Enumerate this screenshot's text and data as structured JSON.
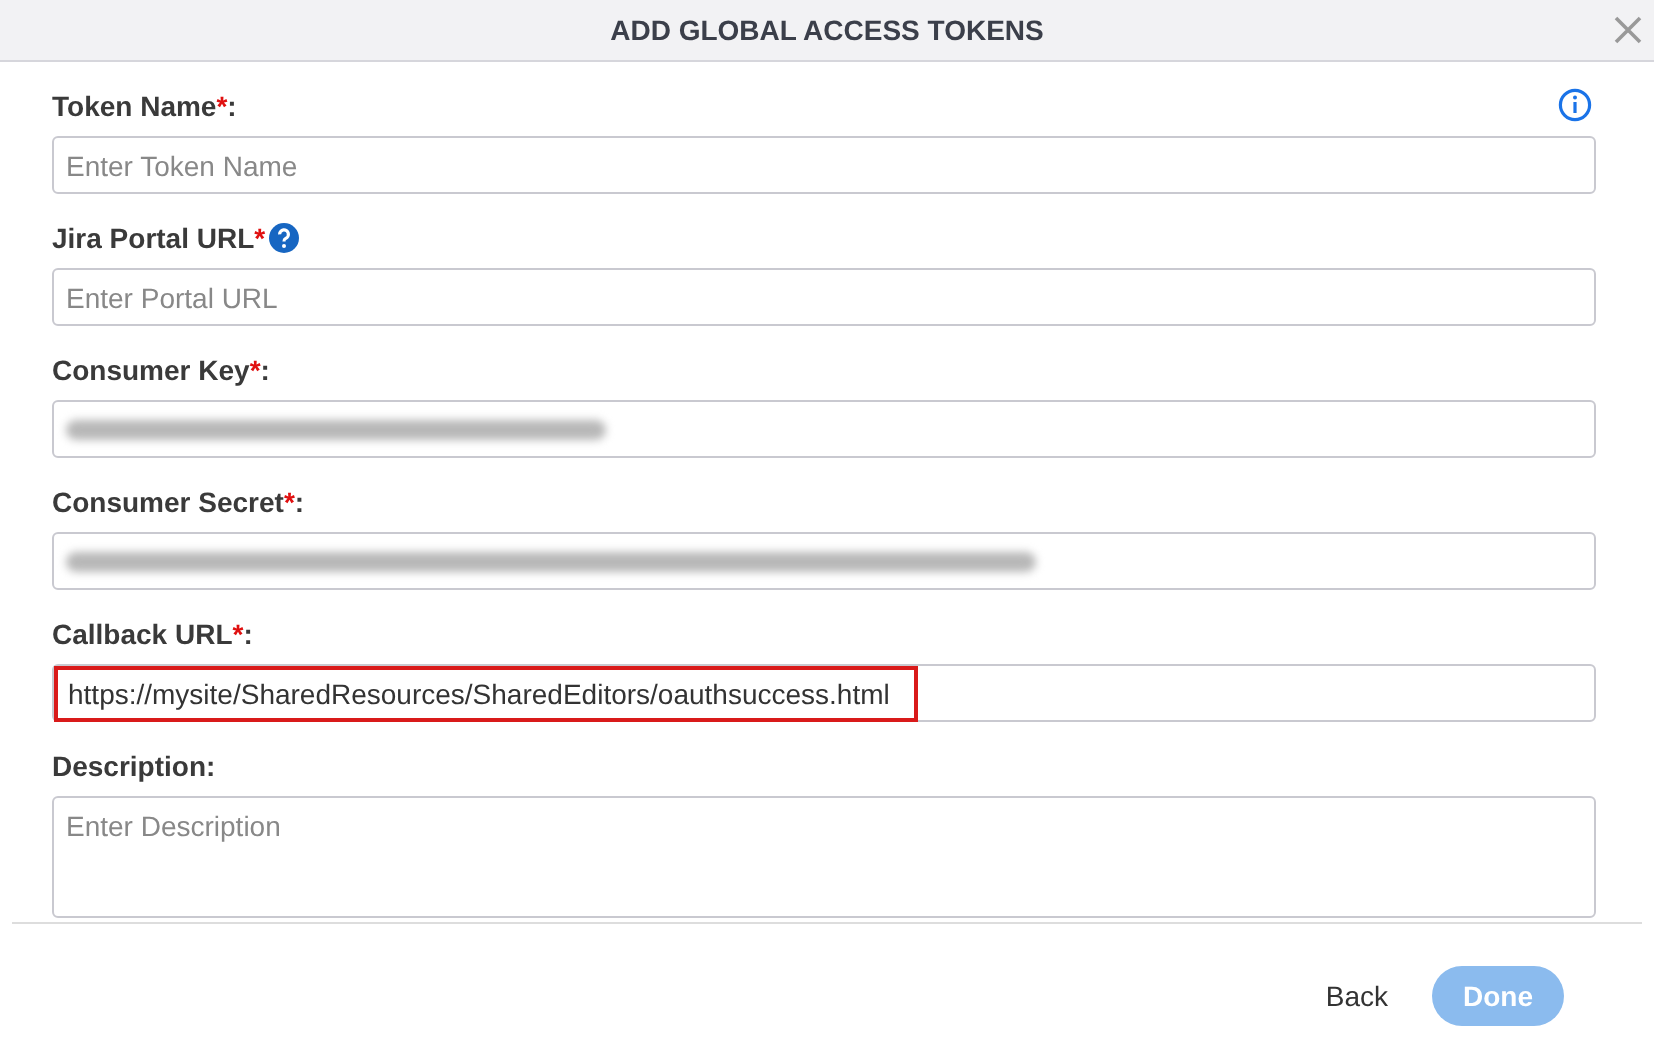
{
  "dialog": {
    "title": "ADD GLOBAL ACCESS TOKENS"
  },
  "fields": [
    {
      "label": "Token Name",
      "required_mark": "*",
      "suffix": ":",
      "help": false,
      "kind": "input",
      "placeholder": "Enter Token Name",
      "highlighted": false
    },
    {
      "label": "Jira Portal URL",
      "required_mark": "*",
      "help": true,
      "kind": "input",
      "placeholder": "Enter Portal URL",
      "highlighted": false
    },
    {
      "label": "Consumer Key",
      "required_mark": "*",
      "suffix": ":",
      "help": false,
      "kind": "redacted",
      "highlighted": false
    },
    {
      "label": "Consumer Secret",
      "required_mark": "*",
      "suffix": ":",
      "help": false,
      "kind": "redacted",
      "highlighted": false
    },
    {
      "label": "Callback URL",
      "required_mark": "*",
      "suffix": ":",
      "help": false,
      "kind": "input",
      "value": "https://mysite/SharedResources/SharedEditors/oauthsuccess.html",
      "highlighted": true
    },
    {
      "label": "Description",
      "suffix": ":",
      "help": false,
      "kind": "textarea",
      "placeholder": "Enter Description",
      "highlighted": false
    }
  ],
  "buttons": [
    {
      "label": "Back",
      "kind": "text",
      "disabled": false
    },
    {
      "label": "Done",
      "kind": "primary",
      "disabled": true
    }
  ]
}
